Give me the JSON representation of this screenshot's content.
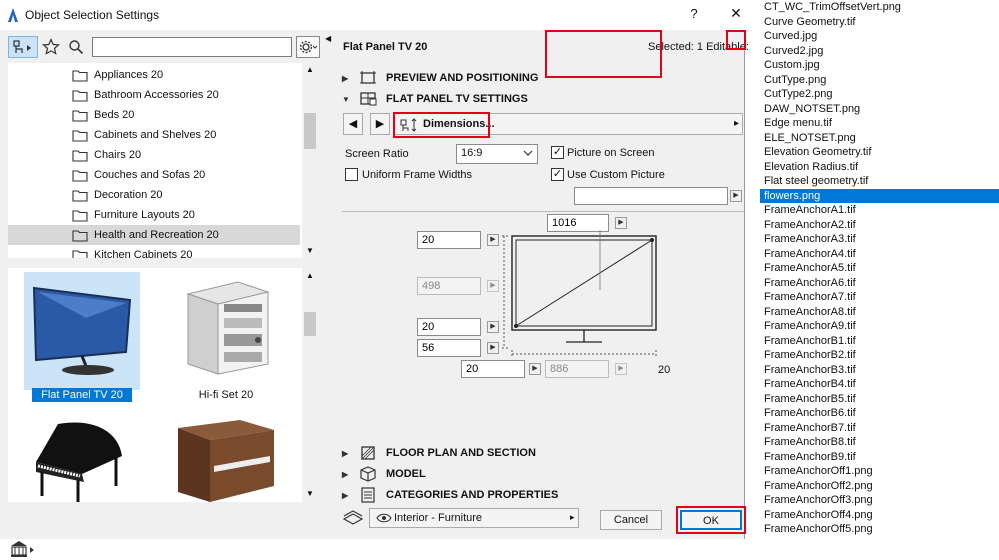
{
  "window": {
    "title": "Object Selection Settings",
    "help": "?",
    "close": "✕"
  },
  "tree": {
    "items": [
      {
        "label": "Appliances 20",
        "selected": false
      },
      {
        "label": "Bathroom Accessories 20",
        "selected": false
      },
      {
        "label": "Beds 20",
        "selected": false
      },
      {
        "label": "Cabinets and Shelves 20",
        "selected": false
      },
      {
        "label": "Chairs 20",
        "selected": false
      },
      {
        "label": "Couches and Sofas 20",
        "selected": false
      },
      {
        "label": "Decoration 20",
        "selected": false
      },
      {
        "label": "Furniture Layouts 20",
        "selected": false
      },
      {
        "label": "Health and Recreation 20",
        "selected": true
      },
      {
        "label": "Kitchen Cabinets 20",
        "selected": false
      }
    ]
  },
  "thumbs": [
    {
      "label": "Flat Panel TV 20",
      "selected": true
    },
    {
      "label": "Hi-fi Set 20",
      "selected": false
    }
  ],
  "panel": {
    "object_name": "Flat Panel TV 20",
    "selected_info": "Selected: 1 Editable:",
    "sections": {
      "preview": "PREVIEW AND POSITIONING",
      "flat_panel": "FLAT PANEL TV SETTINGS",
      "floor_plan": "FLOOR PLAN AND SECTION",
      "model": "MODEL",
      "categories": "CATEGORIES AND PROPERTIES"
    },
    "nav": {
      "prev": "◀",
      "next": "▶",
      "page_label": "Dimensions...",
      "more": "▸"
    },
    "screen_ratio_label": "Screen Ratio",
    "screen_ratio_value": "16:9",
    "uniform_frame_label": "Uniform Frame Widths",
    "picture_on_screen_label": "Picture on Screen",
    "use_custom_picture_label": "Use Custom Picture",
    "custom_picture_value": "",
    "dims": {
      "top_width": "1016",
      "left_top": "20",
      "height": "498",
      "left_bottom": "20",
      "stand": "56",
      "bottom_left": "20",
      "bottom_width": "886",
      "bottom_right": "20"
    },
    "layer": "Interior - Furniture",
    "cancel": "Cancel",
    "ok": "OK"
  },
  "files": {
    "items": [
      {
        "label": "CT_WC_TrimOffsetVert.png",
        "selected": false
      },
      {
        "label": "Curve Geometry.tif",
        "selected": false
      },
      {
        "label": "Curved.jpg",
        "selected": false
      },
      {
        "label": "Curved2.jpg",
        "selected": false
      },
      {
        "label": "Custom.jpg",
        "selected": false
      },
      {
        "label": "CutType.png",
        "selected": false
      },
      {
        "label": "CutType2.png",
        "selected": false
      },
      {
        "label": "DAW_NOTSET.png",
        "selected": false
      },
      {
        "label": "Edge menu.tif",
        "selected": false
      },
      {
        "label": "ELE_NOTSET.png",
        "selected": false
      },
      {
        "label": "Elevation Geometry.tif",
        "selected": false
      },
      {
        "label": "Elevation Radius.tif",
        "selected": false
      },
      {
        "label": "Flat steel geometry.tif",
        "selected": false
      },
      {
        "label": "flowers.png",
        "selected": true
      },
      {
        "label": "FrameAnchorA1.tif",
        "selected": false
      },
      {
        "label": "FrameAnchorA2.tif",
        "selected": false
      },
      {
        "label": "FrameAnchorA3.tif",
        "selected": false
      },
      {
        "label": "FrameAnchorA4.tif",
        "selected": false
      },
      {
        "label": "FrameAnchorA5.tif",
        "selected": false
      },
      {
        "label": "FrameAnchorA6.tif",
        "selected": false
      },
      {
        "label": "FrameAnchorA7.tif",
        "selected": false
      },
      {
        "label": "FrameAnchorA8.tif",
        "selected": false
      },
      {
        "label": "FrameAnchorA9.tif",
        "selected": false
      },
      {
        "label": "FrameAnchorB1.tif",
        "selected": false
      },
      {
        "label": "FrameAnchorB2.tif",
        "selected": false
      },
      {
        "label": "FrameAnchorB3.tif",
        "selected": false
      },
      {
        "label": "FrameAnchorB4.tif",
        "selected": false
      },
      {
        "label": "FrameAnchorB5.tif",
        "selected": false
      },
      {
        "label": "FrameAnchorB6.tif",
        "selected": false
      },
      {
        "label": "FrameAnchorB7.tif",
        "selected": false
      },
      {
        "label": "FrameAnchorB8.tif",
        "selected": false
      },
      {
        "label": "FrameAnchorB9.tif",
        "selected": false
      },
      {
        "label": "FrameAnchorOff1.png",
        "selected": false
      },
      {
        "label": "FrameAnchorOff2.png",
        "selected": false
      },
      {
        "label": "FrameAnchorOff3.png",
        "selected": false
      },
      {
        "label": "FrameAnchorOff4.png",
        "selected": false
      },
      {
        "label": "FrameAnchorOff5.png",
        "selected": false
      }
    ]
  },
  "colors": {
    "accent": "#0078d7",
    "highlight": "#e2001a",
    "selection": "#cce4f7"
  }
}
